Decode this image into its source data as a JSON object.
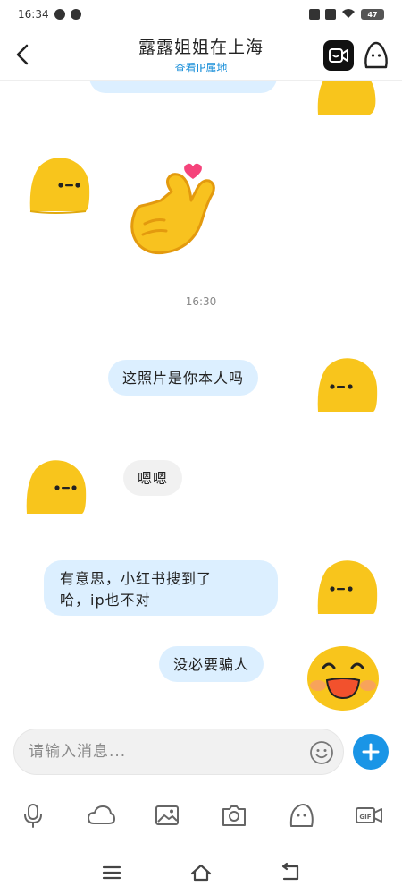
{
  "status_bar": {
    "time": "16:34",
    "battery": "47"
  },
  "header": {
    "title": "露露姐姐在上海",
    "subtitle": "查看IP属地"
  },
  "chat": {
    "timestamp": "16:30",
    "messages": [
      {
        "from": "me",
        "text": "这照片是你本人吗"
      },
      {
        "from": "them",
        "text": "嗯嗯"
      },
      {
        "from": "me",
        "text_line1": "有意思，小红书搜到了",
        "text_line2": "哈，ip也不对"
      },
      {
        "from": "me",
        "text": "没必要骗人"
      }
    ]
  },
  "input": {
    "placeholder": "请输入消息..."
  },
  "colors": {
    "accent": "#1a95e6",
    "my_bubble": "#dcefff",
    "their_bubble": "#f1f1f1",
    "avatar_yellow": "#f8c51c"
  },
  "toolbar_icons": [
    "microphone-icon",
    "cloud-icon",
    "image-icon",
    "camera-icon",
    "emoji-icon",
    "gif-icon"
  ],
  "nav_icons": [
    "menu-icon",
    "home-icon",
    "back-icon"
  ]
}
